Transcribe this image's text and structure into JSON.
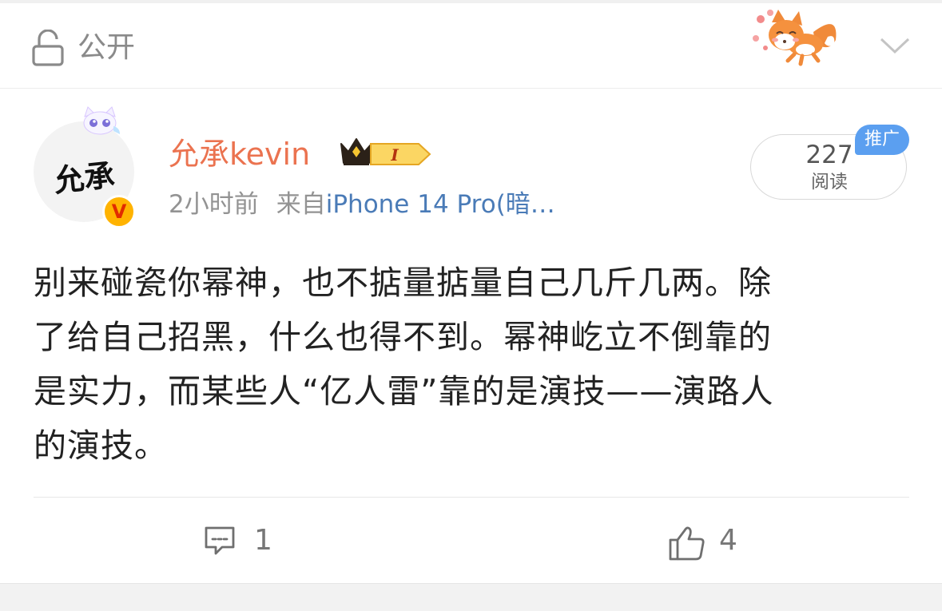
{
  "visibility": {
    "label": "公开",
    "icon": "lock-icon"
  },
  "header_actions": {
    "expand_icon": "chevron-down-icon"
  },
  "author": {
    "avatar_text": "允承",
    "verified_badge": "V",
    "name": "允承kevin",
    "level_badge": "I",
    "level_icon": "crown-icon"
  },
  "post_meta": {
    "time": "2小时前",
    "source_prefix": "来自",
    "source": "iPhone 14 Pro(暗…"
  },
  "stats": {
    "read_count": "227",
    "read_label": "阅读",
    "promo_tag": "推广"
  },
  "post": {
    "lines": [
      "别来碰瓷你幂神，也不掂量掂量自己几斤几两。除",
      "了给自己招黑，什么也得不到。幂神屹立不倒靠的",
      "是实力，而某些人“亿人雷”靠的是演技——演路人",
      "的演技。"
    ]
  },
  "actions": {
    "comment_count": "1",
    "like_count": "4"
  },
  "colors": {
    "username": "#eb7350",
    "link": "#4a7bb7",
    "promo": "#5b9ff0",
    "badge": "#ffb300"
  }
}
